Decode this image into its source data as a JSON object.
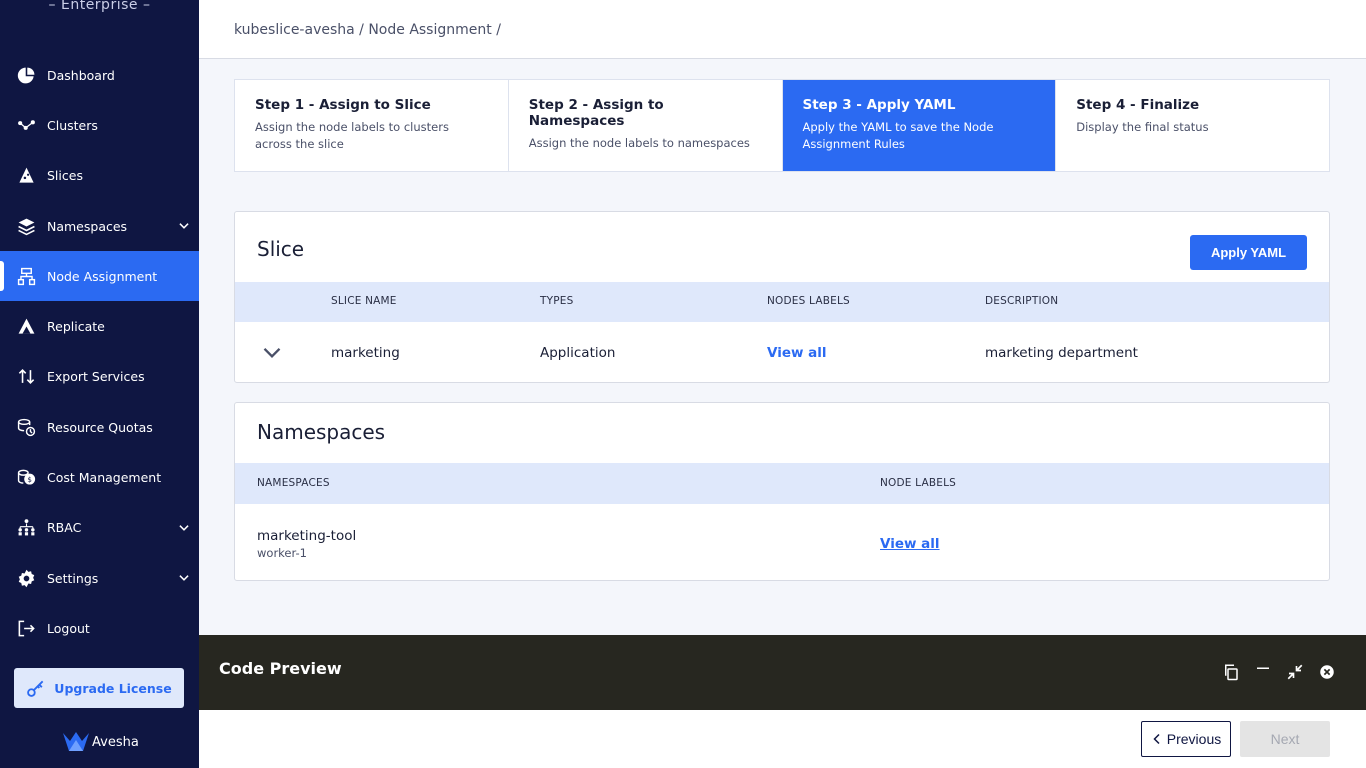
{
  "sidebar": {
    "brand_sub": "– Enterprise –",
    "items": [
      {
        "label": "Dashboard",
        "icon": "pie-chart-icon"
      },
      {
        "label": "Clusters",
        "icon": "clusters-icon"
      },
      {
        "label": "Slices",
        "icon": "slices-icon"
      },
      {
        "label": "Namespaces",
        "icon": "layers-icon"
      },
      {
        "label": "Node Assignment",
        "icon": "sitemap-icon"
      },
      {
        "label": "Replicate",
        "icon": "replicate-icon"
      },
      {
        "label": "Export Services",
        "icon": "arrows-updown-icon"
      },
      {
        "label": "Resource Quotas",
        "icon": "coins-clock-icon"
      },
      {
        "label": "Cost Management",
        "icon": "cost-icon"
      },
      {
        "label": "RBAC",
        "icon": "users-network-icon"
      },
      {
        "label": "Settings",
        "icon": "gear-icon"
      },
      {
        "label": "Logout",
        "icon": "logout-icon"
      }
    ],
    "upgrade_label": "Upgrade License",
    "logo_text": "Avesha"
  },
  "header": {
    "breadcrumb": "kubeslice-avesha / Node Assignment /"
  },
  "stepper": [
    {
      "title": "Step 1 - Assign to Slice",
      "desc": "Assign the node labels to clusters across the slice"
    },
    {
      "title": "Step 2 - Assign to Namespaces",
      "desc": "Assign the node labels to namespaces"
    },
    {
      "title": "Step 3 - Apply YAML",
      "desc": "Apply the YAML to save the Node Assignment Rules"
    },
    {
      "title": "Step 4 - Finalize",
      "desc": "Display the final status"
    }
  ],
  "slice_card": {
    "title": "Slice",
    "apply_label": "Apply YAML",
    "columns": [
      "SLICE NAME",
      "TYPES",
      "NODES LABELS",
      "DESCRIPTION"
    ],
    "row": {
      "name": "marketing",
      "type": "Application",
      "labels": "View all",
      "description": "marketing department"
    }
  },
  "ns_card": {
    "title": "Namespaces",
    "columns": [
      "NAMESPACES",
      "NODE LABELS"
    ],
    "row": {
      "namespace": "marketing-tool",
      "sub": "worker-1",
      "labels": "View all"
    }
  },
  "code_preview": {
    "title": "Code Preview"
  },
  "footer": {
    "previous_label": "Previous",
    "next_label": "Next"
  },
  "colors": {
    "sidebar": "#0f1642",
    "accent": "#2b6af2",
    "table_header": "#dfe8fb",
    "code_bar": "#272720"
  }
}
